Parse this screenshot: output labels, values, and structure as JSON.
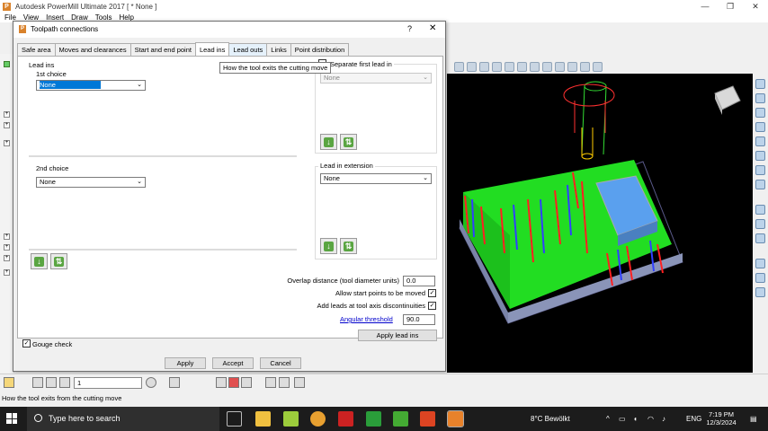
{
  "app": {
    "title": "Autodesk PowerMill Ultimate 2017   [ * None ]",
    "menu": [
      "File",
      "View",
      "Insert",
      "Draw",
      "Tools",
      "Help"
    ]
  },
  "dialog": {
    "title": "Toolpath connections",
    "help": "?",
    "close": "✕",
    "tabs": [
      "Safe area",
      "Moves and clearances",
      "Start and end point",
      "Lead ins",
      "Lead outs",
      "Links",
      "Point distribution"
    ],
    "active_tab": "Lead ins",
    "tooltip": "How the tool exits the cutting move",
    "lead_ins": {
      "group_label": "Lead ins",
      "first_choice_label": "1st choice",
      "first_choice_value": "None",
      "second_choice_label": "2nd choice",
      "second_choice_value": "None",
      "separate_first_label": "Separate first lead in",
      "separate_first_value": "None",
      "extension_label": "Lead in extension",
      "extension_value": "None"
    },
    "fields": {
      "overlap_label": "Overlap distance (tool diameter units)",
      "overlap_value": "0.0",
      "allow_start_label": "Allow start points to be moved",
      "add_leads_label": "Add leads at tool axis discontinuities",
      "angular_label": "Angular threshold",
      "angular_value": "90.0",
      "gouge_label": "Gouge check"
    },
    "buttons": {
      "apply_lead_ins": "Apply lead ins",
      "apply": "Apply",
      "accept": "Accept",
      "cancel": "Cancel"
    }
  },
  "bottom_toolbar": {
    "combo_value": "1"
  },
  "status": {
    "text": "How the tool exits from the cutting move"
  },
  "taskbar": {
    "search_placeholder": "Type here to search",
    "weather": "8°C  Bewölkt",
    "lang": "ENG",
    "time": "7:19 PM",
    "date": "12/3/2024"
  },
  "colors": {
    "accent": "#0078d7",
    "viewport_bg": "#000000",
    "stock_green": "#22dd22",
    "block_blue": "#5aa0ee"
  }
}
